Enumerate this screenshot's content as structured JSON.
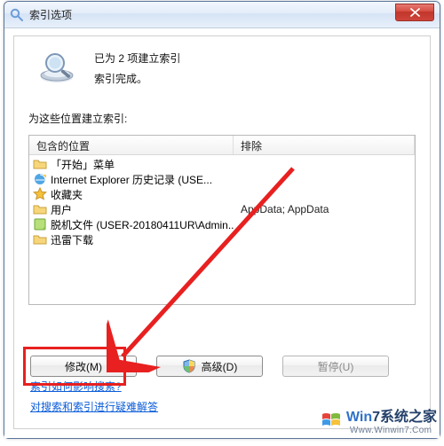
{
  "window": {
    "title": "索引选项"
  },
  "status": {
    "line1": "已为 2 项建立索引",
    "line2": "索引完成。"
  },
  "section_label": "为这些位置建立索引:",
  "listview": {
    "col1": "包含的位置",
    "col2": "排除",
    "rows": [
      {
        "icon": "folder",
        "label": "「开始」菜单",
        "exclude": ""
      },
      {
        "icon": "ie",
        "label": "Internet Explorer 历史记录 (USE...",
        "exclude": ""
      },
      {
        "icon": "star",
        "label": "收藏夹",
        "exclude": ""
      },
      {
        "icon": "folder",
        "label": "用户",
        "exclude": "AppData; AppData"
      },
      {
        "icon": "sticky",
        "label": "脱机文件 (USER-20180411UR\\Admin...",
        "exclude": ""
      },
      {
        "icon": "folder",
        "label": "迅雷下载",
        "exclude": ""
      }
    ]
  },
  "buttons": {
    "modify": "修改(M)",
    "advanced": "高级(D)",
    "pause": "暂停(U)"
  },
  "links": {
    "how": "索引如何影响搜索?",
    "troubleshoot": "对搜索和索引进行疑难解答"
  },
  "watermark": {
    "brand_colored_prefix": "Win",
    "brand_plain_suffix": "7系统之家",
    "sub": "Www.Winwin7.Com"
  }
}
